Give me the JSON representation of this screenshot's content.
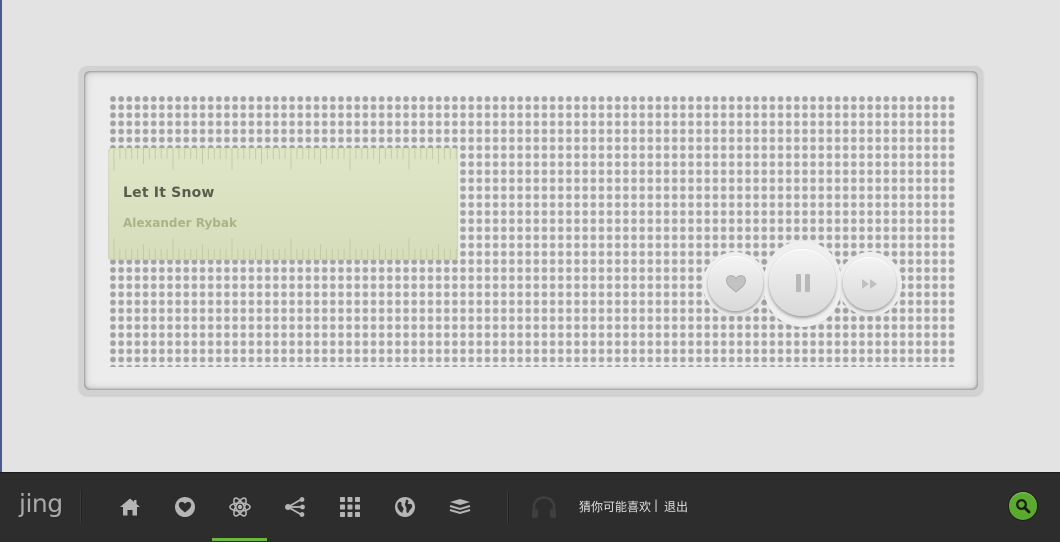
{
  "player": {
    "song_title": "Let It Snow",
    "artist": "Alexander Rybak",
    "controls": {
      "like_icon": "heart-icon",
      "pause_icon": "pause-icon",
      "next_icon": "fast-forward-icon"
    }
  },
  "navbar": {
    "logo": "jing",
    "items": [
      {
        "name": "home",
        "icon": "home-icon",
        "active": false
      },
      {
        "name": "favorites",
        "icon": "heart-icon",
        "active": false
      },
      {
        "name": "discover",
        "icon": "atom-icon",
        "active": true
      },
      {
        "name": "share",
        "icon": "share-icon",
        "active": false
      },
      {
        "name": "apps",
        "icon": "grid-icon",
        "active": false
      },
      {
        "name": "world",
        "icon": "globe-icon",
        "active": false
      },
      {
        "name": "layers",
        "icon": "layers-icon",
        "active": false
      }
    ],
    "listening_icon": "headphones-icon",
    "guess_link": "猜你可能喜欢",
    "separator": "|",
    "logout_link": "退出",
    "search_icon": "search-icon"
  },
  "colors": {
    "accent": "#6cb83c",
    "display_bg": "#dbe2c2",
    "navbar_bg": "#2d2d2d"
  }
}
